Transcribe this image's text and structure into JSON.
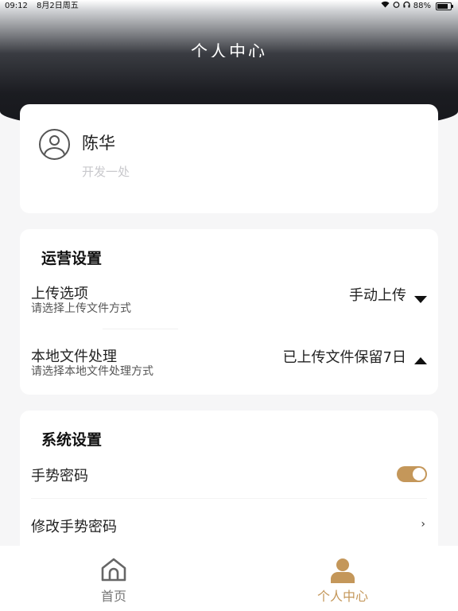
{
  "status_bar": {
    "time": "09:12",
    "date": "8月2日周五",
    "battery": "88%"
  },
  "header": {
    "title": "个人中心"
  },
  "profile": {
    "name": "陈华",
    "subtitle": "开发一处"
  },
  "operations": {
    "title": "运营设置",
    "rows": [
      {
        "label": "上传选项",
        "desc": "请选择上传文件方式",
        "value": "手动上传",
        "indicator": "triangle-down"
      },
      {
        "label": "本地文件处理",
        "desc": "请选择本地文件处理方式",
        "value": "已上传文件保留7日",
        "indicator": "triangle-up"
      }
    ]
  },
  "system": {
    "title": "系统设置",
    "gesture_password": {
      "label": "手势密码",
      "enabled": true
    },
    "modify_gesture": {
      "label": "修改手势密码"
    }
  },
  "tabbar": {
    "items": [
      {
        "label": "首页",
        "icon": "home-icon",
        "active": false
      },
      {
        "label": "个人中心",
        "icon": "person-icon",
        "active": true
      }
    ],
    "active_color": "#c4975a"
  }
}
